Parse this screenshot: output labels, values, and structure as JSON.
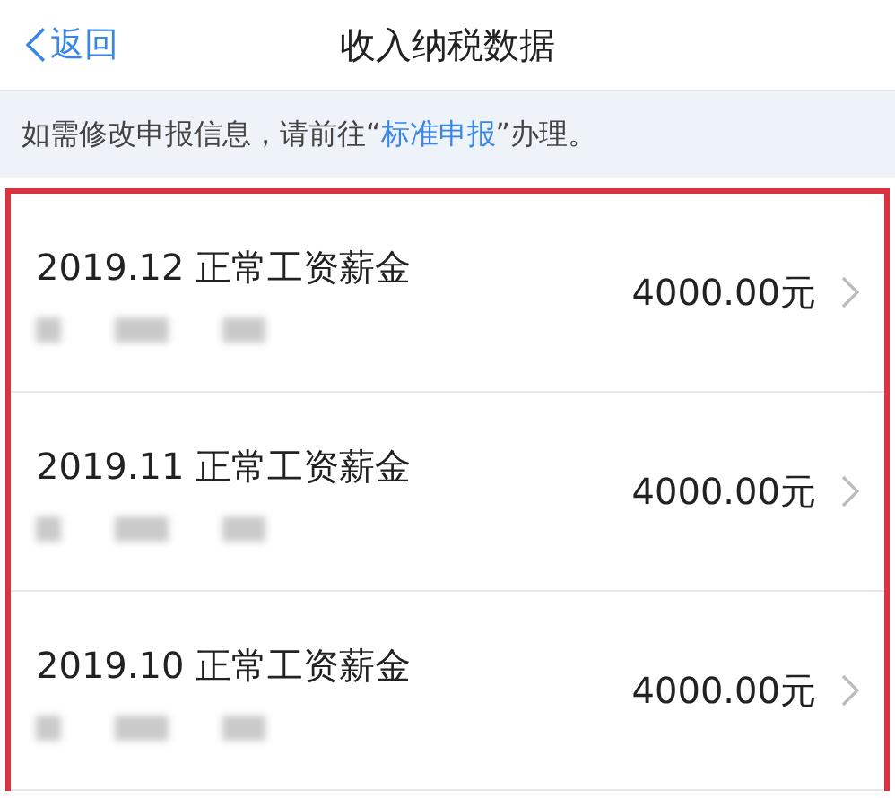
{
  "nav": {
    "back": "返回",
    "title": "收入纳税数据"
  },
  "notice": {
    "before": "如需修改申报信息，请前往“",
    "link": "标准申报",
    "after": "”办理。"
  },
  "records": [
    {
      "title": "2019.12 正常工资薪金",
      "amount": "4000.00元"
    },
    {
      "title": "2019.11 正常工资薪金",
      "amount": "4000.00元"
    },
    {
      "title": "2019.10 正常工资薪金",
      "amount": "4000.00元"
    }
  ]
}
